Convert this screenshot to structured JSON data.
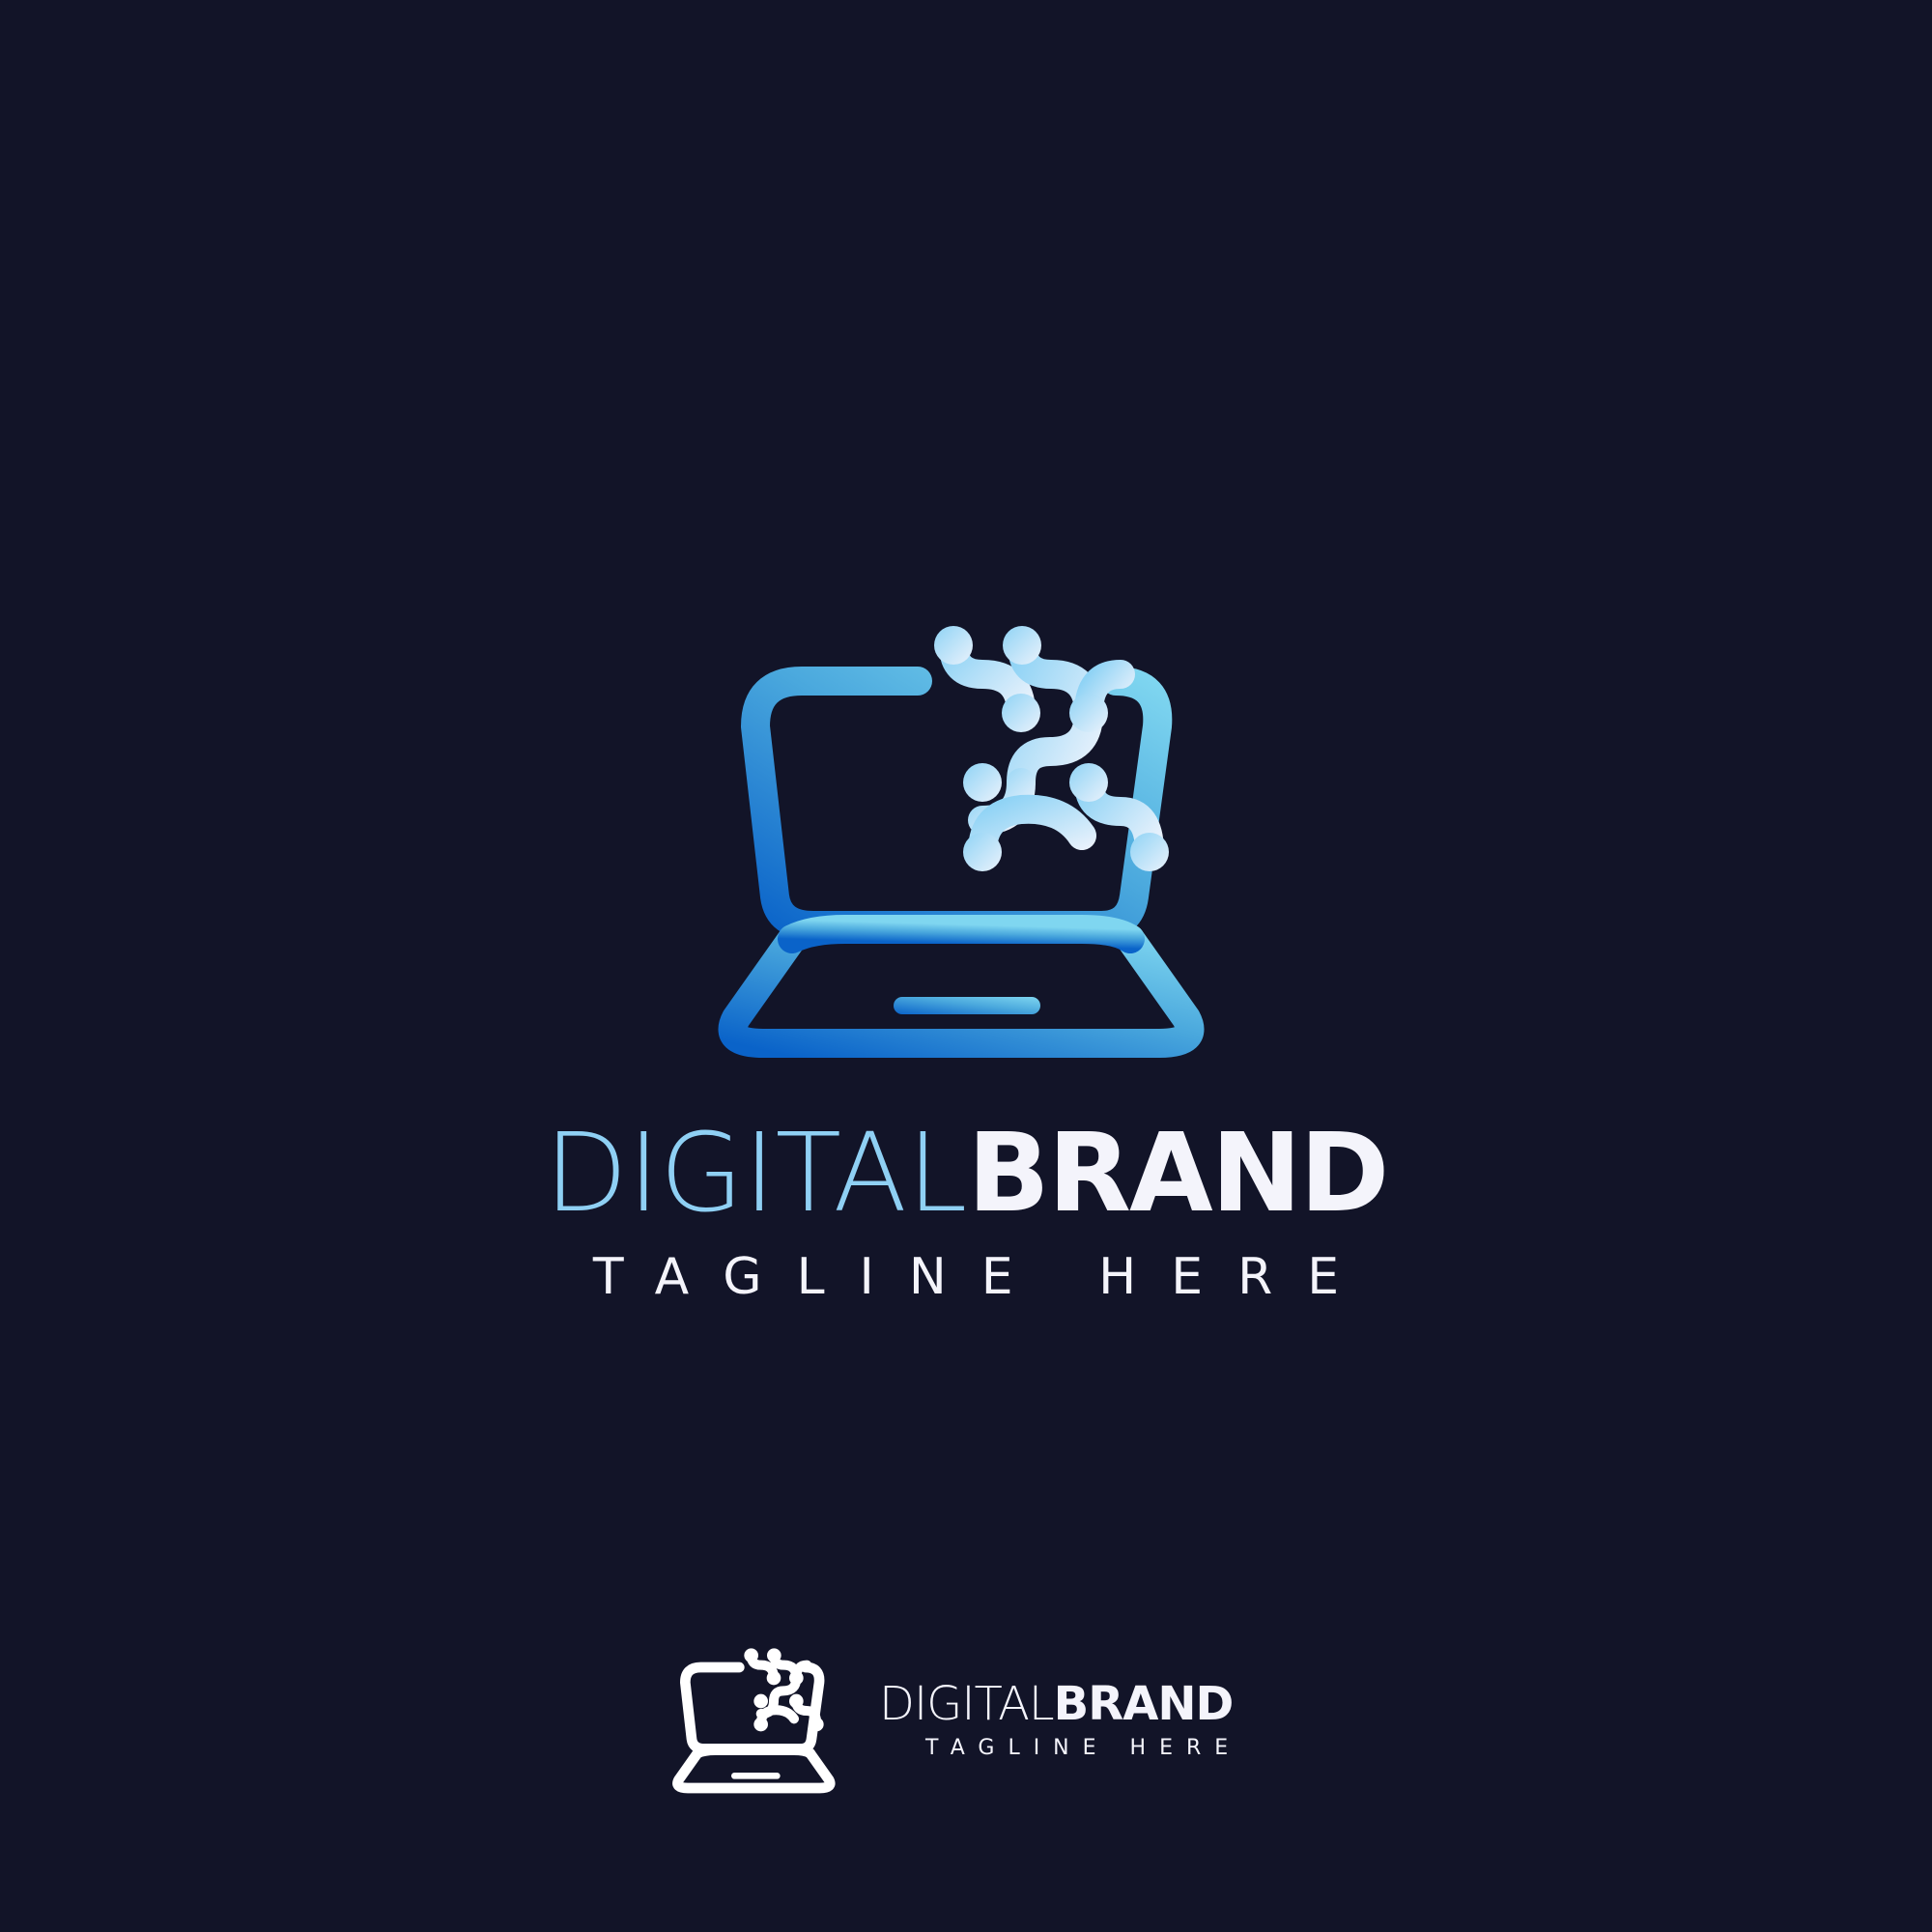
{
  "brand": {
    "name_light": "DIGITAL",
    "name_bold": "BRAND",
    "tagline": "TAGLINE HERE"
  },
  "colors": {
    "background": "#121428",
    "wordmark_light": "#8fd0f4",
    "wordmark_bold": "#f4f4fb",
    "gradient_dark": "#0a63c9",
    "gradient_light": "#7fd6f0",
    "molecule_light": "#e6f0fb",
    "white_version": "#ffffff"
  },
  "icons": {
    "main": "laptop-molecule-gradient-icon",
    "small": "laptop-molecule-white-icon"
  }
}
